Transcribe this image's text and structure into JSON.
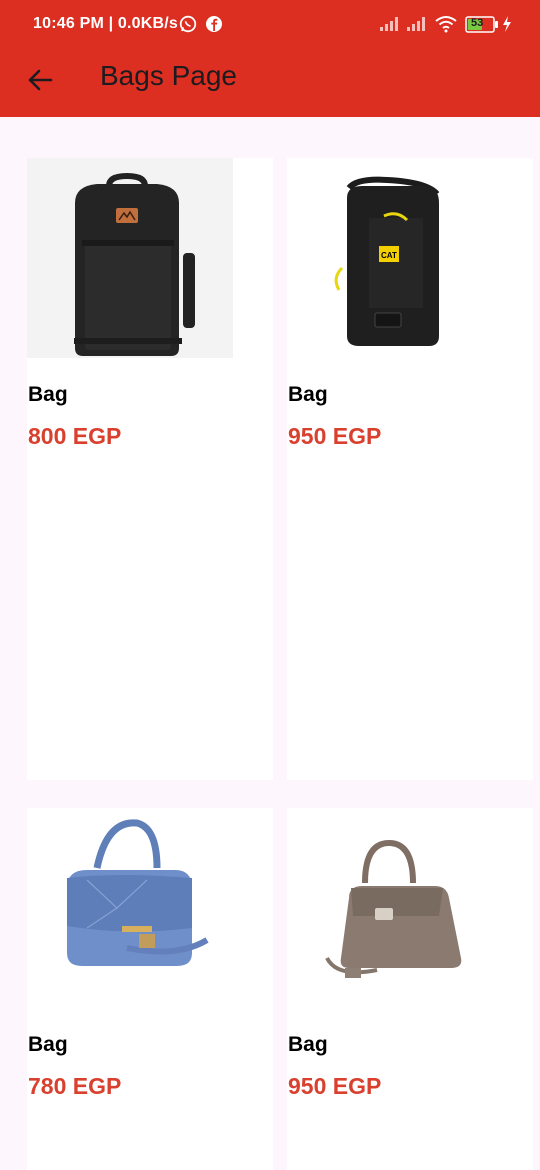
{
  "status_bar": {
    "time_and_speed": "10:46 PM | 0.0KB/s",
    "battery": "53",
    "icons": [
      "whatsapp-icon",
      "facebook-icon",
      "signal-icon",
      "signal-icon",
      "wifi-icon",
      "battery-icon",
      "charging-icon"
    ]
  },
  "app_bar": {
    "title": "Bags Page",
    "back_icon": "arrow-left-icon",
    "background": "#dc2e21"
  },
  "products": [
    {
      "name": "Bag",
      "price": "800 EGP",
      "image": "black-backpack"
    },
    {
      "name": "Bag",
      "price": "950 EGP",
      "image": "black-cat-sling-bag"
    },
    {
      "name": "Bag",
      "price": "780 EGP",
      "image": "blue-handbag"
    },
    {
      "name": "Bag",
      "price": "950 EGP",
      "image": "taupe-handbag"
    }
  ],
  "colors": {
    "price": "#d9402e",
    "page_background": "#fdf6fd",
    "card_background": "#ffffff"
  }
}
